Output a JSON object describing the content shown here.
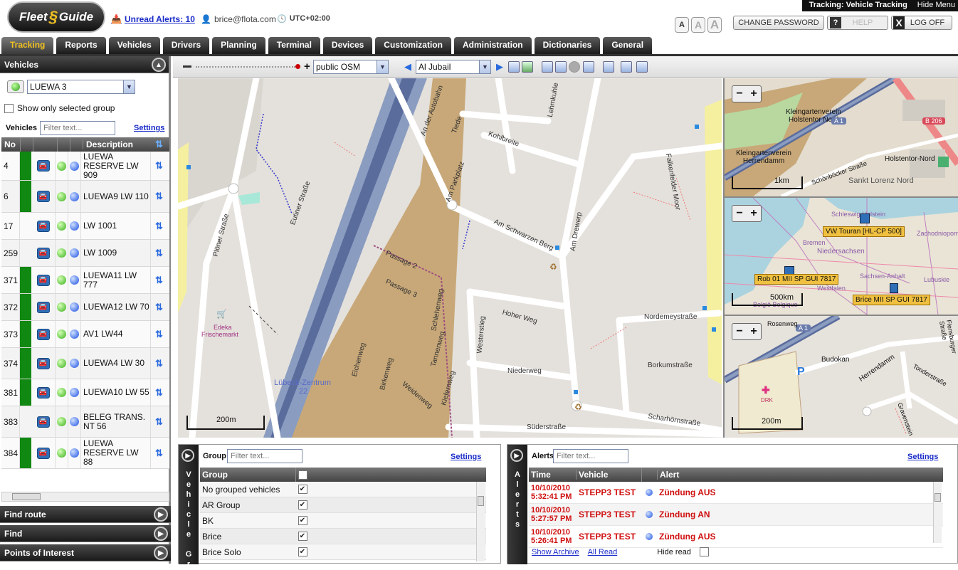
{
  "header": {
    "logo_left": "Fleet",
    "logo_right": "Guide",
    "unread_alerts": "Unread Alerts: 10",
    "user": "brice@flota.com",
    "timezone": "UTC+02:00",
    "page_title": "Tracking: Vehicle Tracking",
    "hide_menu": "Hide Menu",
    "font_sizes": [
      "A",
      "A",
      "A"
    ],
    "change_password": "CHANGE PASSWORD",
    "help": "HELP",
    "logoff": "LOG OFF",
    "help_icon": "?",
    "logoff_icon": "X"
  },
  "tabs": [
    "Tracking",
    "Reports",
    "Vehicles",
    "Drivers",
    "Planning",
    "Terminal",
    "Devices",
    "Customization",
    "Administration",
    "Dictionaries",
    "General"
  ],
  "sidebar": {
    "title": "Vehicles",
    "group": "LUEWA 3",
    "show_only_selected": "Show only selected group",
    "filter_label": "Vehicles",
    "filter_placeholder": "Filter text...",
    "settings": "Settings",
    "col_no": "No",
    "col_desc": "Description",
    "rows": [
      {
        "no": "4",
        "desc": "LUEWA RESERVE LW 909",
        "green": true
      },
      {
        "no": "6",
        "desc": "LUEWA9 LW 110",
        "green": true
      },
      {
        "no": "17",
        "desc": "LW 1001",
        "green": false
      },
      {
        "no": "259",
        "desc": "LW 1009",
        "green": false
      },
      {
        "no": "371",
        "desc": "LUEWA11 LW 777",
        "green": true
      },
      {
        "no": "372",
        "desc": "LUEWA12 LW 70",
        "green": true
      },
      {
        "no": "373",
        "desc": "AV1 LW44",
        "green": true
      },
      {
        "no": "374",
        "desc": "LUEWA4 LW 30",
        "green": true
      },
      {
        "no": "381",
        "desc": "LUEWA10 LW 55",
        "green": true
      },
      {
        "no": "383",
        "desc": "BELEG TRANS. NT 56",
        "green": false
      },
      {
        "no": "384",
        "desc": "LUEWA RESERVE LW 88",
        "green": true
      }
    ],
    "bottom_sections": [
      "Find route",
      "Find",
      "Points of Interest"
    ]
  },
  "map_toolbar": {
    "layer": "public OSM",
    "location": "Al Jubail"
  },
  "main_map": {
    "scale": "200m",
    "labels": [
      "Am Drewerp",
      "Am Schwarzen Berg",
      "Kohlbreite",
      "Lehmkuhle",
      "Eutiner Straße",
      "Plöner Straße",
      "Passage 2",
      "Passage 3",
      "Am Parkplatz",
      "Hoher Weg",
      "Nordemeystraße",
      "Borkumstraße",
      "Westerstieg",
      "Niederweg",
      "Scharhörnstraße",
      "Süderstraße",
      "Lübeck-Zentrum",
      "22",
      "Edeka",
      "Frischemarkt",
      "Falkenfelder Moor",
      "Eichenweg",
      "Birkenweg",
      "Weidenweg",
      "Tannenweg",
      "Kiefernweg",
      "Schlehenweg",
      "An der Autobahn",
      "Tiede"
    ]
  },
  "minimaps": [
    {
      "scale": "1km",
      "labels": [
        "Kleingartenverein Holstentor Nord",
        "Kleingartenverein Herrendamm",
        "Holstentor-Nord",
        "Sankt Lorenz Nord",
        "A 1",
        "B 206",
        "Schönböcker Straße"
      ]
    },
    {
      "scale": "500km",
      "labels": [
        "Schleswig-Holstein",
        "Bremen",
        "Niedersachsen",
        "Sachsen-Anhalt",
        "Westfalen",
        "België Belgique",
        "Lubuskie",
        "Zachodniopomo"
      ],
      "vehicles": [
        "VW Touran [HL-CP 500]",
        "Rob 01 MII SP GUI 7817",
        "Brice MII SP GUI 7817"
      ]
    },
    {
      "scale": "200m",
      "labels": [
        "Budokan",
        "Herrendamm",
        "Tonderstraße",
        "A 1",
        "DRK",
        "P",
        "Gravenstein",
        "Flensburger Straße",
        "Rosenweg"
      ]
    }
  ],
  "group_panel": {
    "vertical_title": "Vehicle Gr",
    "header": "Group",
    "filter_placeholder": "Filter text...",
    "settings": "Settings",
    "col": "Group",
    "rows": [
      "No grouped vehicles",
      "AR Group",
      "BK",
      "Brice",
      "Brice Solo"
    ]
  },
  "alerts_panel": {
    "vertical_title": "Alerts",
    "header": "Alerts",
    "filter_placeholder": "Filter text...",
    "settings": "Settings",
    "col_time": "Time",
    "col_vehicle": "Vehicle",
    "col_alert": "Alert",
    "rows": [
      {
        "date": "10/10/2010",
        "time": "5:32:41 PM",
        "vehicle": "STEPP3 TEST",
        "alert": "Zündung AUS"
      },
      {
        "date": "10/10/2010",
        "time": "5:27:57 PM",
        "vehicle": "STEPP3 TEST",
        "alert": "Zündung AN"
      },
      {
        "date": "10/10/2010",
        "time": "5:26:41 PM",
        "vehicle": "STEPP3 TEST",
        "alert": "Zündung AUS"
      }
    ],
    "show_archive": "Show Archive",
    "all_read": "All Read",
    "hide_read": "Hide read"
  }
}
